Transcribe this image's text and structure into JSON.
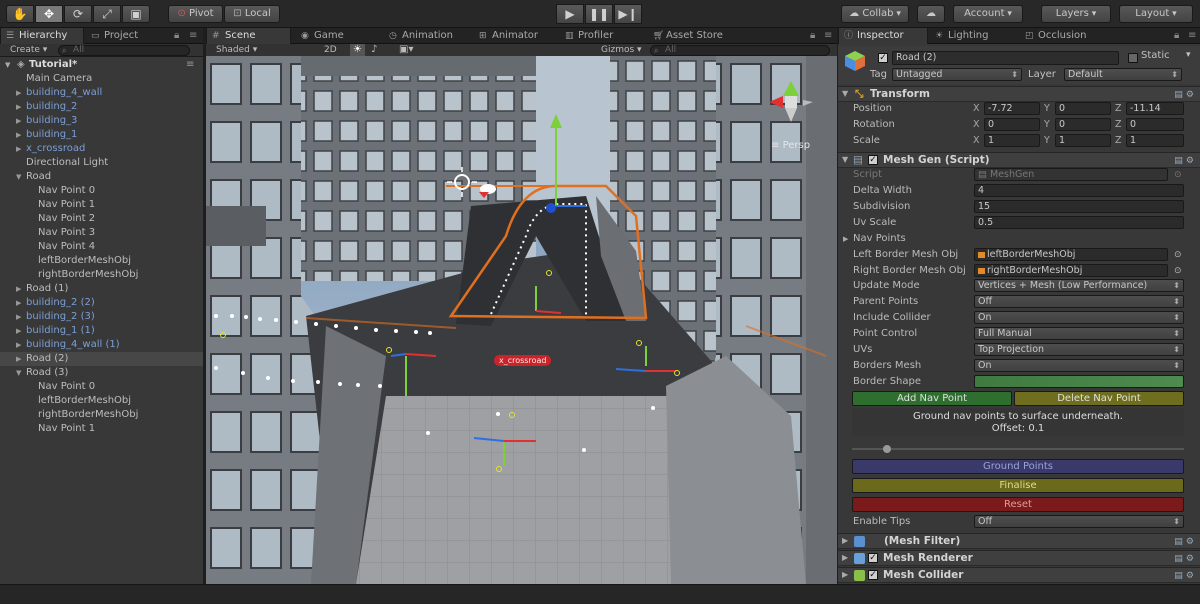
{
  "toolbar": {
    "pivot": "Pivot",
    "local": "Local",
    "collab": "Collab",
    "account": "Account",
    "layers": "Layers",
    "layout": "Layout"
  },
  "hierarchy": {
    "tab_label": "Hierarchy",
    "project_tab": "Project",
    "create_label": "Create",
    "search_placeholder": "All",
    "scene_name": "Tutorial*",
    "items": [
      {
        "label": "Main Camera",
        "prefab": false
      },
      {
        "label": "building_4_wall",
        "prefab": true
      },
      {
        "label": "building_2",
        "prefab": true
      },
      {
        "label": "building_3",
        "prefab": true
      },
      {
        "label": "building_1",
        "prefab": true
      },
      {
        "label": "x_crossroad",
        "prefab": true
      },
      {
        "label": "Directional Light",
        "prefab": false
      },
      {
        "label": "Road",
        "prefab": false
      },
      {
        "label": "Nav Point 0",
        "prefab": false
      },
      {
        "label": "Nav Point 1",
        "prefab": false
      },
      {
        "label": "Nav Point 2",
        "prefab": false
      },
      {
        "label": "Nav Point 3",
        "prefab": false
      },
      {
        "label": "Nav Point 4",
        "prefab": false
      },
      {
        "label": "leftBorderMeshObj",
        "prefab": false
      },
      {
        "label": "rightBorderMeshObj",
        "prefab": false
      },
      {
        "label": "Road (1)",
        "prefab": false
      },
      {
        "label": "building_2 (2)",
        "prefab": true
      },
      {
        "label": "building_2 (3)",
        "prefab": true
      },
      {
        "label": "building_1 (1)",
        "prefab": true
      },
      {
        "label": "building_4_wall (1)",
        "prefab": true
      },
      {
        "label": "Road (2)",
        "prefab": false,
        "selected": true
      },
      {
        "label": "Road (3)",
        "prefab": false
      },
      {
        "label": "Nav Point 0",
        "prefab": false
      },
      {
        "label": "leftBorderMeshObj",
        "prefab": false
      },
      {
        "label": "rightBorderMeshObj",
        "prefab": false
      },
      {
        "label": "Nav Point 1",
        "prefab": false
      }
    ]
  },
  "center_tabs": {
    "scene": "Scene",
    "game": "Game",
    "animation": "Animation",
    "animator": "Animator",
    "profiler": "Profiler",
    "asset_store": "Asset Store"
  },
  "scene_bar": {
    "shading": "Shaded",
    "mode_2d": "2D",
    "gizmos": "Gizmos",
    "search_placeholder": "All"
  },
  "viewport": {
    "persp_label": "Persp",
    "crossroad_label": "x_crossroad"
  },
  "inspector": {
    "tab_label": "Inspector",
    "lighting_tab": "Lighting",
    "occlusion_tab": "Occlusion",
    "object_name": "Road (2)",
    "static_label": "Static",
    "tag_label": "Tag",
    "tag_value": "Untagged",
    "layer_label": "Layer",
    "layer_value": "Default",
    "transform": {
      "title": "Transform",
      "position_label": "Position",
      "rotation_label": "Rotation",
      "scale_label": "Scale",
      "position": [
        "-7.72",
        "0",
        "-11.14"
      ],
      "rotation": [
        "0",
        "0",
        "0"
      ],
      "scale": [
        "1",
        "1",
        "1"
      ]
    },
    "meshgen": {
      "title": "Mesh Gen (Script)",
      "script_label": "Script",
      "script_value": "MeshGen",
      "delta_width_label": "Delta Width",
      "delta_width": "4",
      "subdivision_label": "Subdivision",
      "subdivision": "15",
      "uv_scale_label": "Uv Scale",
      "uv_scale": "0.5",
      "nav_points_label": "Nav Points",
      "left_border_label": "Left Border Mesh Obj",
      "left_border_value": "leftBorderMeshObj",
      "right_border_label": "Right Border Mesh Obj",
      "right_border_value": "rightBorderMeshObj",
      "update_mode_label": "Update Mode",
      "update_mode": "Vertices + Mesh (Low Performance)",
      "parent_points_label": "Parent Points",
      "parent_points": "Off",
      "include_collider_label": "Include Collider",
      "include_collider": "On",
      "point_control_label": "Point Control",
      "point_control": "Full Manual",
      "uvs_label": "UVs",
      "uvs": "Top Projection",
      "borders_mesh_label": "Borders Mesh",
      "borders_mesh": "On",
      "border_shape_label": "Border Shape",
      "add_nav_point": "Add Nav Point",
      "delete_nav_point": "Delete Nav Point",
      "help_line1": "Ground nav points to surface underneath.",
      "help_line2": "Offset: 0.1",
      "ground_points": "Ground Points",
      "finalise": "Finalise",
      "reset": "Reset",
      "enable_tips_label": "Enable Tips",
      "enable_tips": "Off"
    },
    "mesh_filter": "(Mesh Filter)",
    "mesh_renderer": "Mesh Renderer",
    "mesh_collider": "Mesh Collider"
  },
  "colors": {
    "prefab_text": "#7b9fd6",
    "add_button": "#2e6e2e",
    "delete_button": "#6e6e1e",
    "ground_button": "#3a3a6a",
    "finalise_button": "#6a6a1a",
    "reset_button": "#7a1a1a",
    "nav_line": "#e07020"
  }
}
